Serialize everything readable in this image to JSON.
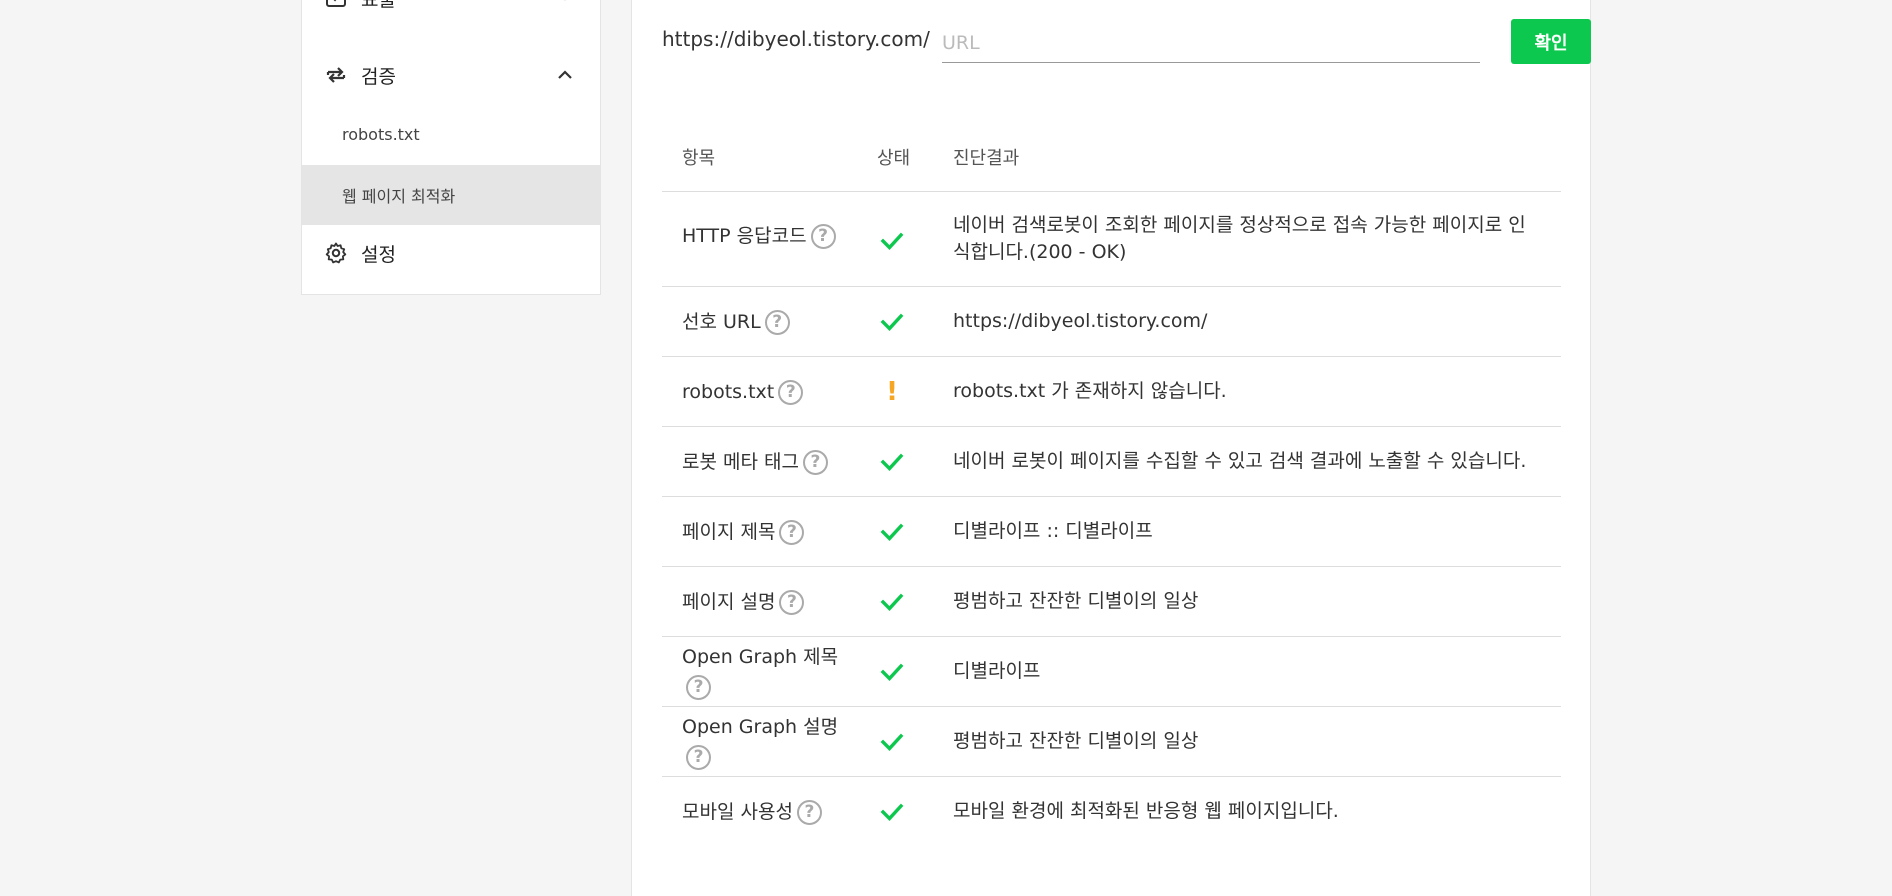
{
  "sidebar": {
    "top_item_label": "표출",
    "section": {
      "label": "검증",
      "icon": "swap-arrows-icon",
      "expanded": true
    },
    "sub_items": [
      {
        "label": "robots.txt",
        "active": false
      },
      {
        "label": "웹 페이지 최적화",
        "active": true
      }
    ],
    "settings": {
      "label": "설정",
      "icon": "gear-icon"
    }
  },
  "url_bar": {
    "prefix": "https://dibyeol.tistory.com/",
    "placeholder": "URL",
    "value": "",
    "confirm_label": "확인"
  },
  "table": {
    "headers": {
      "item": "항목",
      "status": "상태",
      "result": "진단결과"
    },
    "rows": [
      {
        "item": "HTTP 응답코드",
        "status": "ok",
        "result": "네이버 검색로봇이 조회한 페이지를 정상적으로 접속 가능한 페이지로 인식합니다.(200 - OK)"
      },
      {
        "item": "선호 URL",
        "status": "ok",
        "result": "https://dibyeol.tistory.com/"
      },
      {
        "item": "robots.txt",
        "status": "warning",
        "result": "robots.txt 가 존재하지 않습니다."
      },
      {
        "item": "로봇 메타 태그",
        "status": "ok",
        "result": "네이버 로봇이 페이지를 수집할 수 있고 검색 결과에 노출할 수 있습니다."
      },
      {
        "item": "페이지 제목",
        "status": "ok",
        "result": "디별라이프 :: 디별라이프"
      },
      {
        "item": "페이지 설명",
        "status": "ok",
        "result": "평범하고 잔잔한 디별이의 일상"
      },
      {
        "item": "Open Graph 제목",
        "status": "ok",
        "result": "디별라이프"
      },
      {
        "item": "Open Graph 설명",
        "status": "ok",
        "result": "평범하고 잔잔한 디별이의 일상"
      },
      {
        "item": "모바일 사용성",
        "status": "ok",
        "result": "모바일 환경에 최적화된 반응형 웹 페이지입니다."
      }
    ],
    "help_glyph": "?",
    "warning_glyph": "!"
  },
  "colors": {
    "accent": "#0dc84f",
    "ok": "#0dc84f",
    "warning": "#f5a623"
  }
}
